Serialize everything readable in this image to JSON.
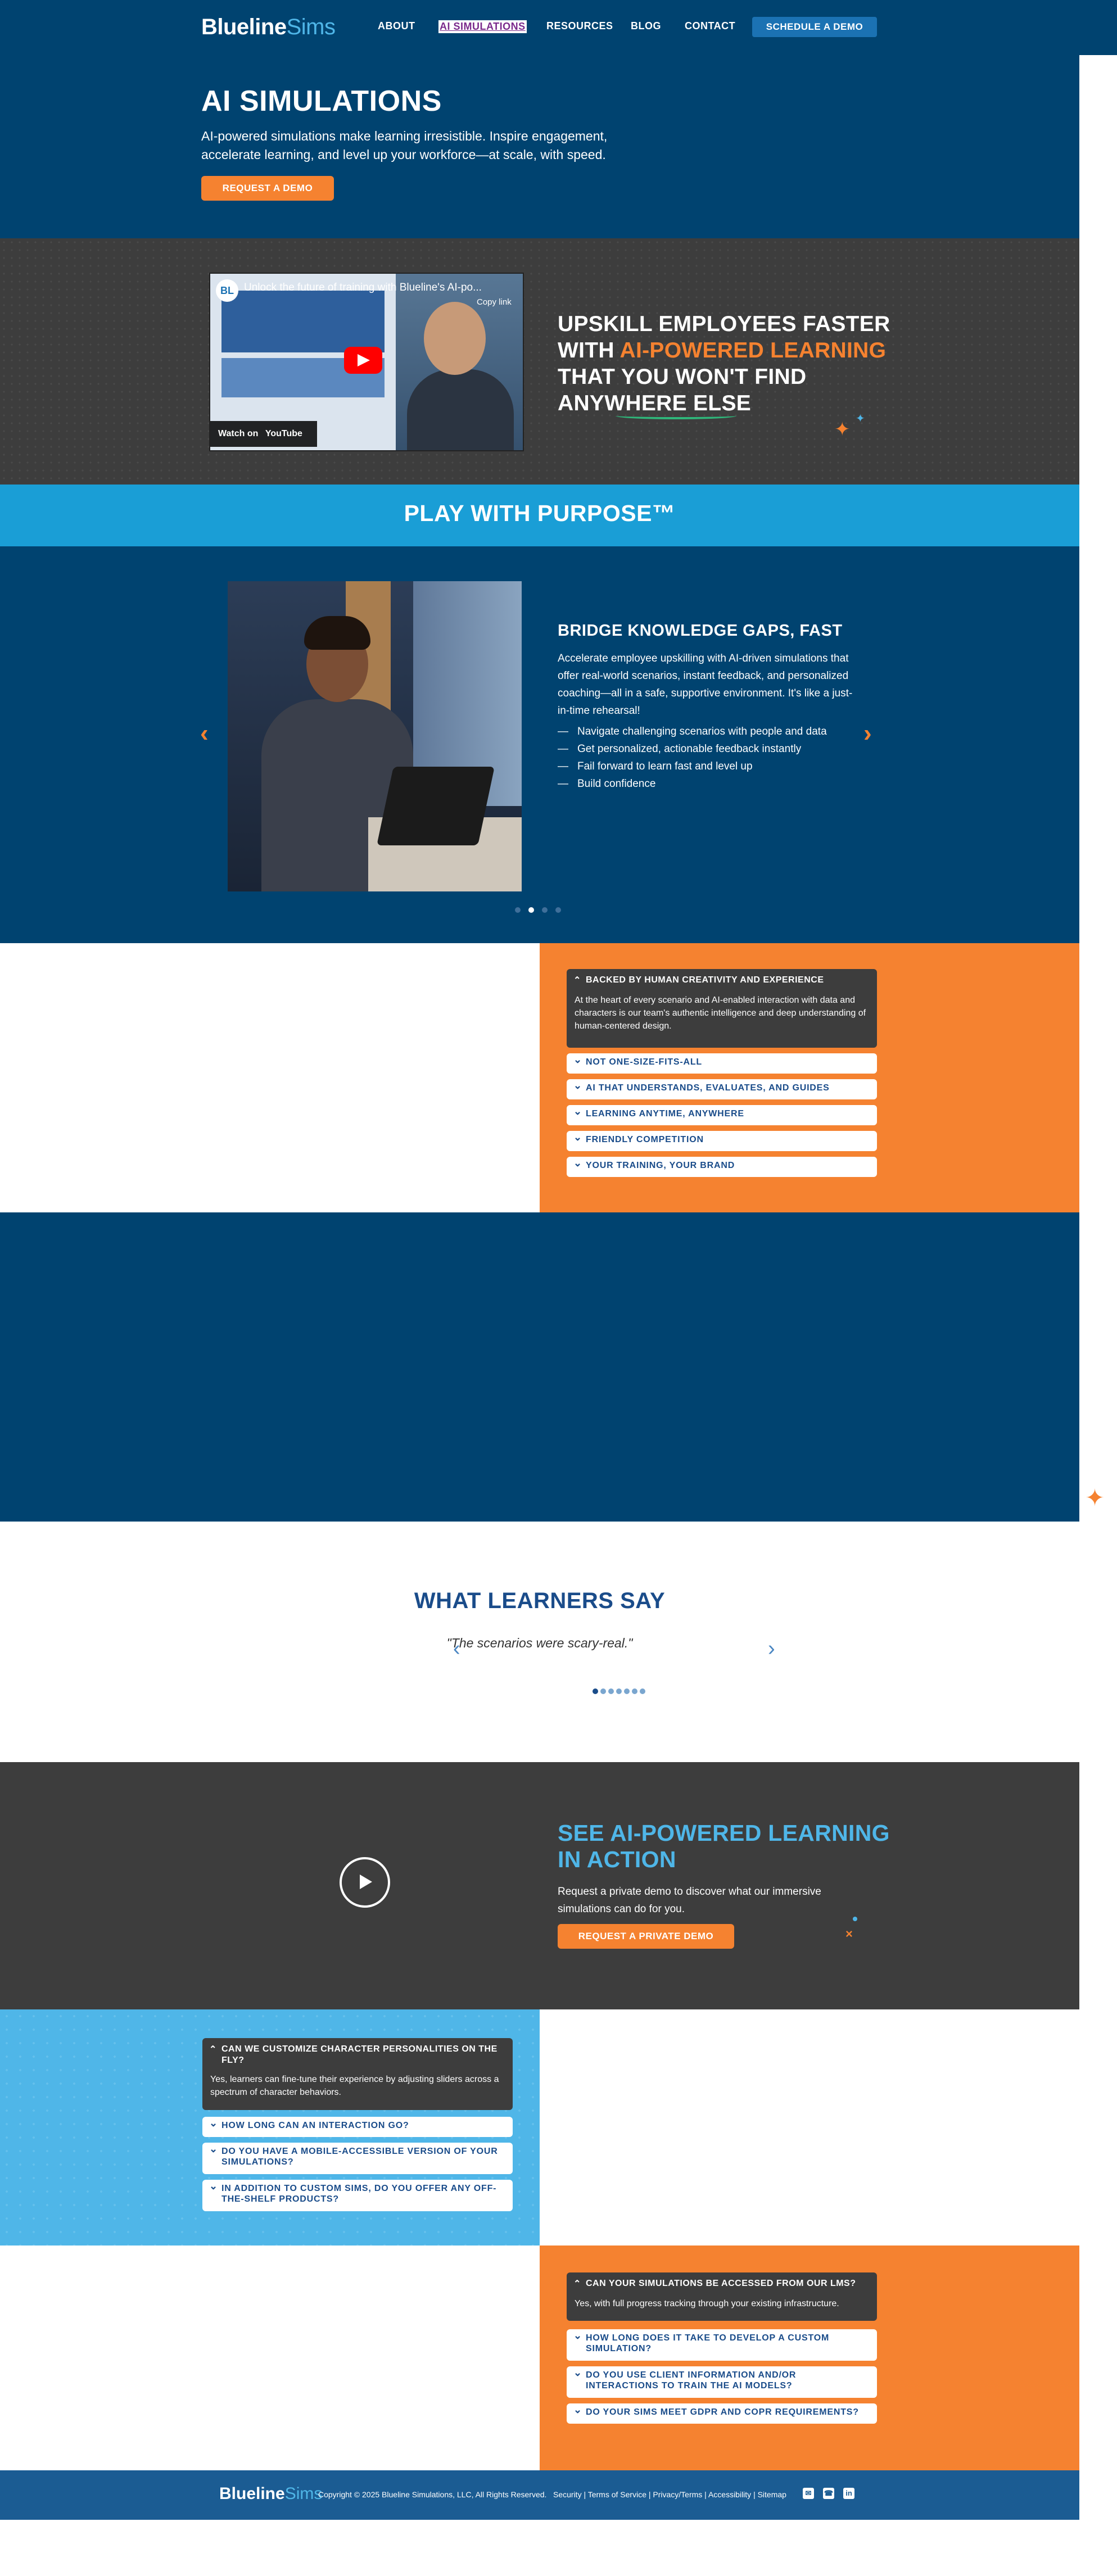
{
  "brand": {
    "name_part1": "Blueline",
    "name_part2": "Sims"
  },
  "nav": {
    "items": [
      "ABOUT",
      "AI SIMULATIONS",
      "RESOURCES",
      "BLOG",
      "CONTACT"
    ],
    "active": "AI SIMULATIONS",
    "cta": "SCHEDULE A DEMO"
  },
  "hero": {
    "title": "AI SIMULATIONS",
    "subtitle": "AI-powered simulations make learning irresistible. Inspire engagement, accelerate learning, and level up your workforce—at scale, with speed.",
    "cta": "REQUEST A DEMO"
  },
  "video": {
    "avatar": "BL",
    "title": "Unlock the future of training with Blueline's AI-po...",
    "copy_link": "Copy link",
    "watch_on": "Watch on",
    "youtube": "YouTube",
    "headline_part1": "UPSKILL EMPLOYEES FASTER WITH ",
    "headline_highlight": "AI-POWERED LEARNING",
    "headline_part2": " THAT YOU WON'T FIND ANYWHERE ELSE"
  },
  "banner": {
    "text": "PLAY WITH PURPOSE™"
  },
  "carousel": {
    "title": "BRIDGE KNOWLEDGE GAPS, FAST",
    "description": "Accelerate employee upskilling with AI-driven simulations that offer real-world scenarios, instant feedback, and personalized coaching—all in a safe, supportive environment. It's like a just-in-time rehearsal!",
    "bullets": [
      "Navigate challenging scenarios with people and data",
      "Get personalized, actionable feedback instantly",
      "Fail forward to learn fast and level up",
      "Build confidence"
    ],
    "slide_count": 4,
    "active_slide": 2
  },
  "features_accordion": {
    "open_title": "BACKED BY HUMAN CREATIVITY AND EXPERIENCE",
    "open_body": "At the heart of every scenario and AI-enabled interaction with data and characters is our team's authentic intelligence and deep understanding of human-centered design.",
    "items": [
      "NOT ONE-SIZE-FITS-ALL",
      "AI THAT UNDERSTANDS, EVALUATES, AND GUIDES",
      "LEARNING ANYTIME, ANYWHERE",
      "FRIENDLY COMPETITION",
      "YOUR TRAINING, YOUR BRAND"
    ]
  },
  "testimonials": {
    "title": "WHAT LEARNERS SAY",
    "quote": "\"The scenarios were scary-real.\"",
    "slide_count": 7,
    "active_slide": 1
  },
  "action": {
    "title": "SEE AI-POWERED LEARNING IN ACTION",
    "description": "Request a private demo to discover what our immersive simulations can do for you.",
    "cta": "REQUEST A PRIVATE DEMO"
  },
  "faq1": {
    "open_title": "CAN WE CUSTOMIZE CHARACTER PERSONALITIES ON THE FLY?",
    "open_body": "Yes, learners can fine-tune their experience by adjusting sliders across a spectrum of character behaviors.",
    "items": [
      "HOW LONG CAN AN INTERACTION GO?",
      "DO YOU HAVE A MOBILE-ACCESSIBLE VERSION OF YOUR SIMULATIONS?",
      "IN ADDITION TO CUSTOM SIMS, DO YOU OFFER ANY OFF-THE-SHELF PRODUCTS?"
    ]
  },
  "faq2": {
    "open_title": "CAN YOUR SIMULATIONS BE ACCESSED FROM OUR LMS?",
    "open_body": "Yes, with full progress tracking through your existing infrastructure.",
    "items": [
      "HOW LONG DOES IT TAKE TO DEVELOP A CUSTOM SIMULATION?",
      "DO YOU USE CLIENT INFORMATION AND/OR INTERACTIONS TO TRAIN THE AI MODELS?",
      "DO YOUR SIMS MEET GDPR AND COPR REQUIREMENTS?"
    ]
  },
  "footer": {
    "copyright": "Copyright © 2025 Blueline Simulations, LLC, All Rights Reserved.",
    "links": "Security | Terms of Service | Privacy/Terms | Accessibility | Sitemap",
    "icons": [
      "email-icon",
      "phone-icon",
      "linkedin-icon"
    ]
  },
  "colors": {
    "navy": "#004370",
    "orange": "#f58230",
    "sky": "#4fb6e8",
    "banner_blue": "#1a9ed6",
    "charcoal": "#3d3d3d"
  }
}
